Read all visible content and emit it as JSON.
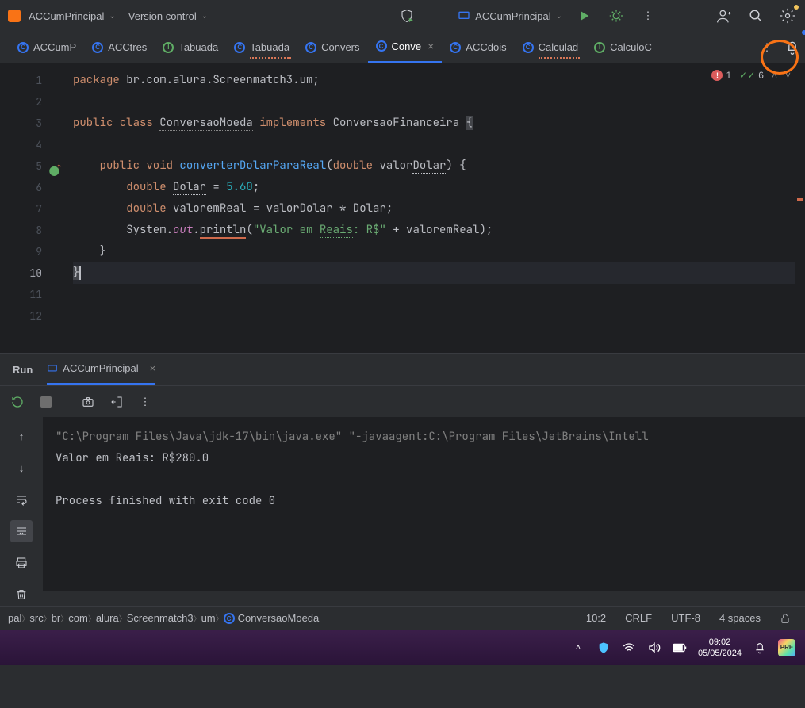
{
  "header": {
    "project_dropdown": "ACCumPrincipal",
    "vcs_dropdown": "Version control",
    "run_config": "ACCumPrincipal"
  },
  "tabs": [
    {
      "label": "ACCumP",
      "icon": "blue"
    },
    {
      "label": "ACCtres",
      "icon": "blue"
    },
    {
      "label": "Tabuada",
      "icon": "green"
    },
    {
      "label": "Tabuada",
      "icon": "blue",
      "underline": true
    },
    {
      "label": "Convers",
      "icon": "blue"
    },
    {
      "label": "Conve",
      "icon": "blue",
      "active": true,
      "close": true
    },
    {
      "label": "ACCdois",
      "icon": "blue"
    },
    {
      "label": "Calculad",
      "icon": "blue",
      "underline": true
    },
    {
      "label": "CalculoC",
      "icon": "green"
    }
  ],
  "inspections": {
    "errors": "1",
    "warnings": "6"
  },
  "code": {
    "lines": [
      1,
      2,
      3,
      4,
      5,
      6,
      7,
      8,
      9,
      10,
      11,
      12
    ],
    "marker_line": 5,
    "current_line": 10,
    "hl_line": 10,
    "package_line": "package br.com.alura.Screenmatch3.um;",
    "class_line_kw": "public class ",
    "class_name": "ConversaoMoeda",
    "implements_kw": " implements ",
    "iface": "ConversaoFinanceira",
    "method_kw": "public void ",
    "method_name": "converterDolarParaReal",
    "method_sig_open": "(",
    "double_kw": "double ",
    "param": "valorDolar",
    "method_sig_close": ") {",
    "l6_kw": "double ",
    "l6_var": "Dolar",
    "l6_eq": " = ",
    "l6_num": "5.60",
    "l6_semi": ";",
    "l7_kw": "double ",
    "l7_var": "valoremReal",
    "l7_rest": " = valorDolar * Dolar;",
    "l8_sys": "System.",
    "l8_out": "out",
    "l8_dot": ".",
    "l8_println": "println",
    "l8_open": "(",
    "l8_str1": "\"Valor em ",
    "l8_reais": "Reais",
    "l8_str2": ": R$\"",
    "l8_rest": " + valoremReal);",
    "l9": "}",
    "l10": "}"
  },
  "run": {
    "title": "Run",
    "tab": "ACCumPrincipal",
    "console_cmd": "\"C:\\Program Files\\Java\\jdk-17\\bin\\java.exe\" \"-javaagent:C:\\Program Files\\JetBrains\\Intell",
    "console_out": "Valor em Reais: R$280.0",
    "console_exit": "Process finished with exit code 0"
  },
  "breadcrumb": {
    "items": [
      "pal",
      "src",
      "br",
      "com",
      "alura",
      "Screenmatch3",
      "um",
      "ConversaoMoeda"
    ],
    "caret": "10:2",
    "crlf": "CRLF",
    "encoding": "UTF-8",
    "indent": "4 spaces"
  },
  "taskbar": {
    "time": "09:02",
    "date": "05/05/2024",
    "pre": "PRE"
  }
}
